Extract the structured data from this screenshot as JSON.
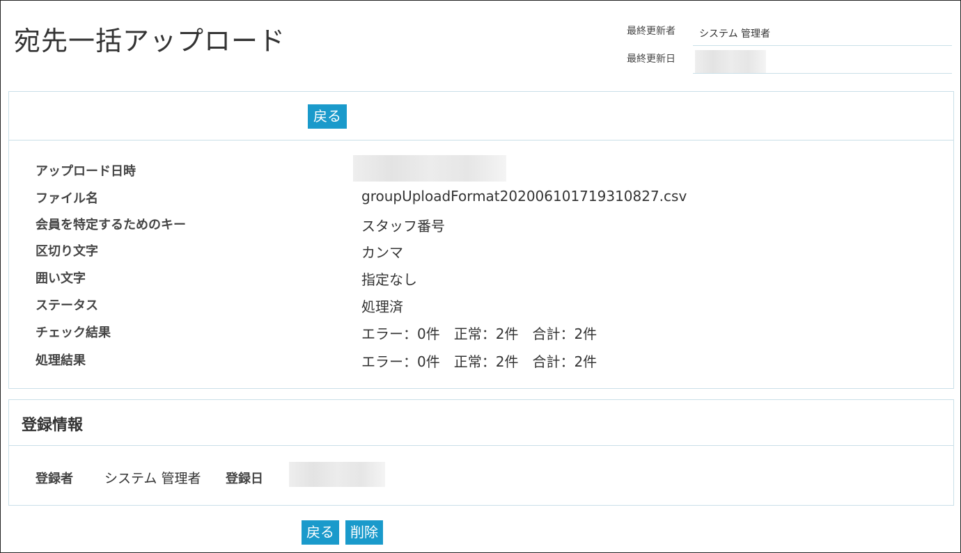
{
  "page": {
    "title": "宛先一括アップロード"
  },
  "meta": {
    "updated_by_label": "最終更新者",
    "updated_by_value": "システム 管理者",
    "updated_date_label": "最終更新日"
  },
  "buttons": {
    "back": "戻る",
    "delete": "削除"
  },
  "detail": {
    "upload_datetime_label": "アップロード日時",
    "filename_label": "ファイル名",
    "filename_value": "groupUploadFormat202006101719310827.csv",
    "key_label": "会員を特定するためのキー",
    "key_value": "スタッフ番号",
    "delimiter_label": "区切り文字",
    "delimiter_value": "カンマ",
    "enclosure_label": "囲い文字",
    "enclosure_value": "指定なし",
    "status_label": "ステータス",
    "status_value": "処理済",
    "check_result_label": "チェック結果",
    "check_result_value": "エラー：0件　正常：2件　合計：2件",
    "process_result_label": "処理結果",
    "process_result_value": "エラー：0件　正常：2件　合計：2件"
  },
  "registration": {
    "title": "登録情報",
    "registrant_label": "登録者",
    "registrant_value": "システム 管理者",
    "registered_date_label": "登録日"
  }
}
